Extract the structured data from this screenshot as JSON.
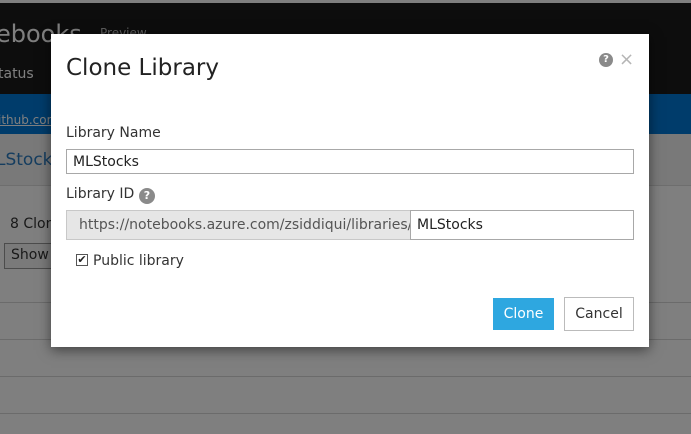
{
  "background": {
    "brand": "ebooks",
    "preview_label": "Preview",
    "nav_status": "tatus",
    "link_text": "ithub.com",
    "page_title": "LStock",
    "clone_count": "8 Clon",
    "show_label": "Show"
  },
  "modal": {
    "title": "Clone Library",
    "help_glyph": "?",
    "close_glyph": "×",
    "library_name_label": "Library Name",
    "library_name_value": "MLStocks",
    "library_id_label": "Library ID",
    "library_id_help_glyph": "?",
    "url_prefix": "https://notebooks.azure.com/zsiddiqui/libraries/",
    "library_id_value": "MLStocks",
    "public_checkbox_label": "Public library",
    "public_checked": true,
    "clone_button": "Clone",
    "cancel_button": "Cancel"
  },
  "colors": {
    "header": "#1a1a1a",
    "accent_blue": "#0078d7",
    "primary_button": "#2ea7e0"
  }
}
